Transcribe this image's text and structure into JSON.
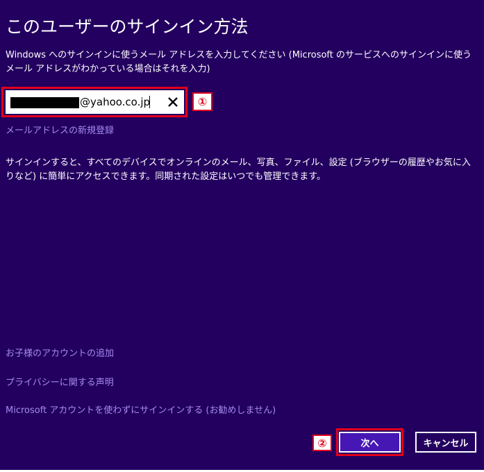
{
  "dialog": {
    "title": "このユーザーのサインイン方法",
    "description": "Windows へのサインインに使うメール アドレスを入力してください (Microsoft のサービスへのサインインに使うメール アドレスがわかっている場合はそれを入力)",
    "email_value": "@yahoo.co.jp",
    "new_email_link": "メールアドレスの新規登録",
    "info_text": "サインインすると、すべてのデバイスでオンラインのメール、写真、ファイル、設定 (ブラウザーの履歴やお気に入りなど) に簡単にアクセスできます。同期された設定はいつでも管理できます。",
    "links": {
      "child_account": "お子様のアカウントの追加",
      "privacy": "プライバシーに関する声明",
      "local_account": "Microsoft アカウントを使わずにサインインする (お勧めしません)"
    },
    "buttons": {
      "next": "次へ",
      "cancel": "キャンセル"
    }
  },
  "annotations": {
    "marker_1": "①",
    "marker_2": "②"
  },
  "icons": {
    "clear": "close-icon"
  },
  "colors": {
    "background": "#23005f",
    "link": "#a38bf0",
    "highlight": "#e3001b",
    "primary_button": "#4617b4"
  }
}
